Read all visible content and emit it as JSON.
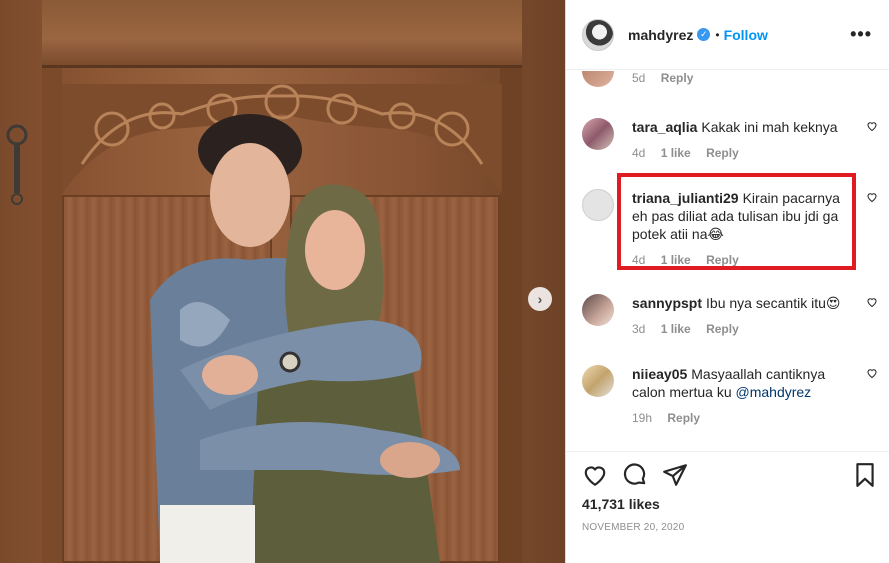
{
  "post": {
    "username": "mahdyrez",
    "follow_label": "Follow",
    "separator": "•",
    "more_label": "•••",
    "next_arrow": "›"
  },
  "comments": [
    {
      "username": "",
      "text": "",
      "time": "5d",
      "likes": "",
      "reply": "Reply",
      "avatar_color": "#c99a80"
    },
    {
      "username": "tara_aqlia",
      "text": "Kakak ini mah keknya",
      "time": "4d",
      "likes": "1 like",
      "reply": "Reply"
    },
    {
      "username": "triana_julianti29",
      "text": "Kirain pacarnya eh pas diliat ada tulisan ibu jdi ga potek atii na😂",
      "time": "4d",
      "likes": "1 like",
      "reply": "Reply",
      "highlighted": true,
      "highlight_color": "#e11b22"
    },
    {
      "username": "sannypspt",
      "text": "Ibu nya secantik itu😍",
      "time": "3d",
      "likes": "1 like",
      "reply": "Reply"
    },
    {
      "username": "niieay05",
      "text": "Masyaallah cantiknya calon mertua ku ",
      "mention": "@mahdyrez",
      "time": "19h",
      "likes": "",
      "reply": "Reply"
    }
  ],
  "actions": {
    "icons": [
      "heart-icon",
      "comment-icon",
      "share-icon",
      "bookmark-icon"
    ],
    "likes_count": "41,731 likes",
    "date": "NOVEMBER 20, 2020"
  },
  "colors": {
    "accent": "#0095f6",
    "verified": "#3897f0",
    "text": "#262626",
    "muted": "#8e8e8e"
  }
}
